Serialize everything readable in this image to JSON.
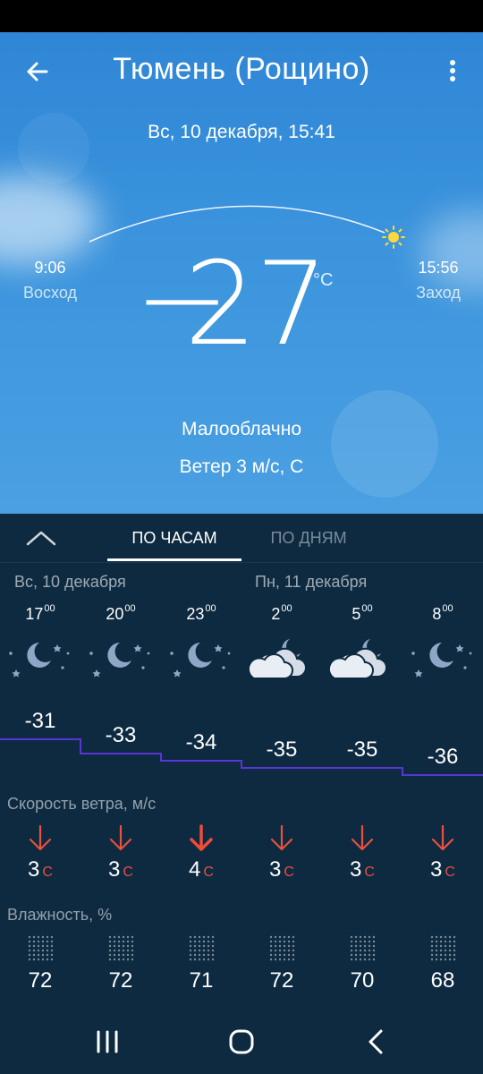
{
  "header": {
    "title": "Тюмень (Рощино)",
    "datetime": "Вс, 10 декабря, 15:41"
  },
  "sun": {
    "sunrise_time": "9:06",
    "sunrise_label": "Восход",
    "sunset_time": "15:56",
    "sunset_label": "Заход"
  },
  "current": {
    "temperature": "27",
    "sign": "−",
    "unit": "°C",
    "condition": "Малооблачно",
    "wind": "Ветер 3 м/с, С"
  },
  "tabs": {
    "hourly": "ПО ЧАСАМ",
    "daily": "ПО ДНЯМ"
  },
  "days": {
    "day1": "Вс, 10 декабря",
    "day2": "Пн, 11 декабря"
  },
  "hourly": [
    {
      "hour": "17",
      "min": "00",
      "icon": "night-clear-icon",
      "temp": "-31",
      "wind": "3",
      "wind_dir": "С",
      "humidity": "72"
    },
    {
      "hour": "20",
      "min": "00",
      "icon": "night-clear-icon",
      "temp": "-33",
      "wind": "3",
      "wind_dir": "С",
      "humidity": "72"
    },
    {
      "hour": "23",
      "min": "00",
      "icon": "night-clear-icon",
      "temp": "-34",
      "wind": "4",
      "wind_dir": "С",
      "humidity": "71"
    },
    {
      "hour": "2",
      "min": "00",
      "icon": "night-cloudy-icon",
      "temp": "-35",
      "wind": "3",
      "wind_dir": "С",
      "humidity": "72"
    },
    {
      "hour": "5",
      "min": "00",
      "icon": "night-cloudy-icon",
      "temp": "-35",
      "wind": "3",
      "wind_dir": "С",
      "humidity": "70"
    },
    {
      "hour": "8",
      "min": "00",
      "icon": "night-clear-icon",
      "temp": "-36",
      "wind": "3",
      "wind_dir": "С",
      "humidity": "68"
    }
  ],
  "sections": {
    "wind_title": "Скорость ветра, м/с",
    "humidity_title": "Влажность, %"
  },
  "colors": {
    "panel": "#0d2a40",
    "temp_line": "#5a35d6",
    "wind_arrow": "#e8503f",
    "wind_arrow_strong": "#f24b3b"
  }
}
